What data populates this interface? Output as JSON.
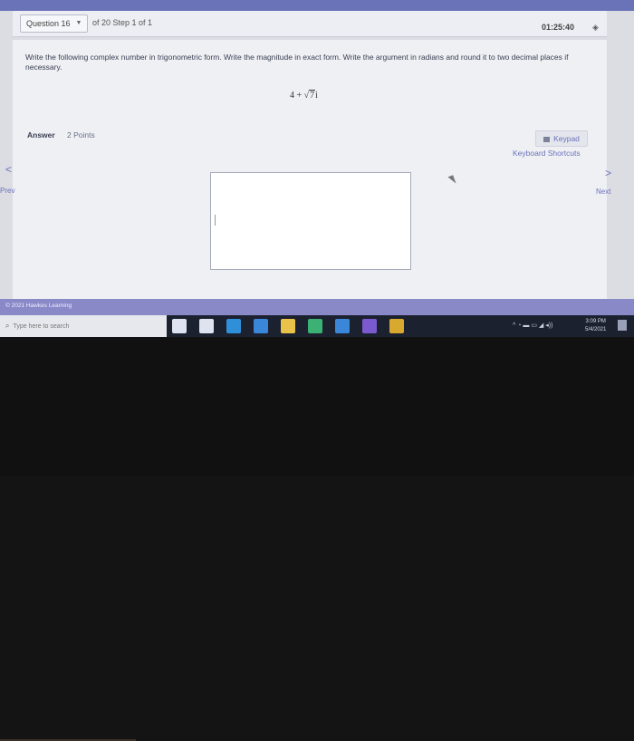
{
  "header": {
    "question_label": "Question 16",
    "of_step": "of 20 Step 1 of 1",
    "timer": "01:25:40"
  },
  "question": {
    "prompt": "Write the following complex number in trigonometric form. Write the magnitude in exact form. Write the argument in radians and round it to two decimal places if necessary.",
    "expr_prefix": "4 + ",
    "expr_radicand": "7",
    "expr_suffix": "i"
  },
  "answer": {
    "label": "Answer",
    "points": "2 Points",
    "keypad": "Keypad",
    "shortcuts": "Keyboard Shortcuts",
    "value": ""
  },
  "nav": {
    "prev_arrow": "<",
    "prev": "Prev",
    "next_arrow": ">",
    "next": "Next"
  },
  "footer": {
    "copyright": "© 2021 Hawkes Learning"
  },
  "taskbar": {
    "search_placeholder": "Type here to search",
    "time": "3:09 PM",
    "date": "5/4/2021",
    "icons": [
      {
        "name": "cortana-icon",
        "color": "#dfe3f0"
      },
      {
        "name": "task-view-icon",
        "color": "#dfe3f0"
      },
      {
        "name": "edge-icon",
        "color": "#2f8fd8"
      },
      {
        "name": "store-icon",
        "color": "#3a86d8"
      },
      {
        "name": "file-explorer-icon",
        "color": "#e9c24a"
      },
      {
        "name": "app-green-icon",
        "color": "#3bb173"
      },
      {
        "name": "app-blue-icon",
        "color": "#3a86d8"
      },
      {
        "name": "app-purple-icon",
        "color": "#7b5ad0"
      },
      {
        "name": "chrome-icon",
        "color": "#d9a82f"
      }
    ]
  }
}
